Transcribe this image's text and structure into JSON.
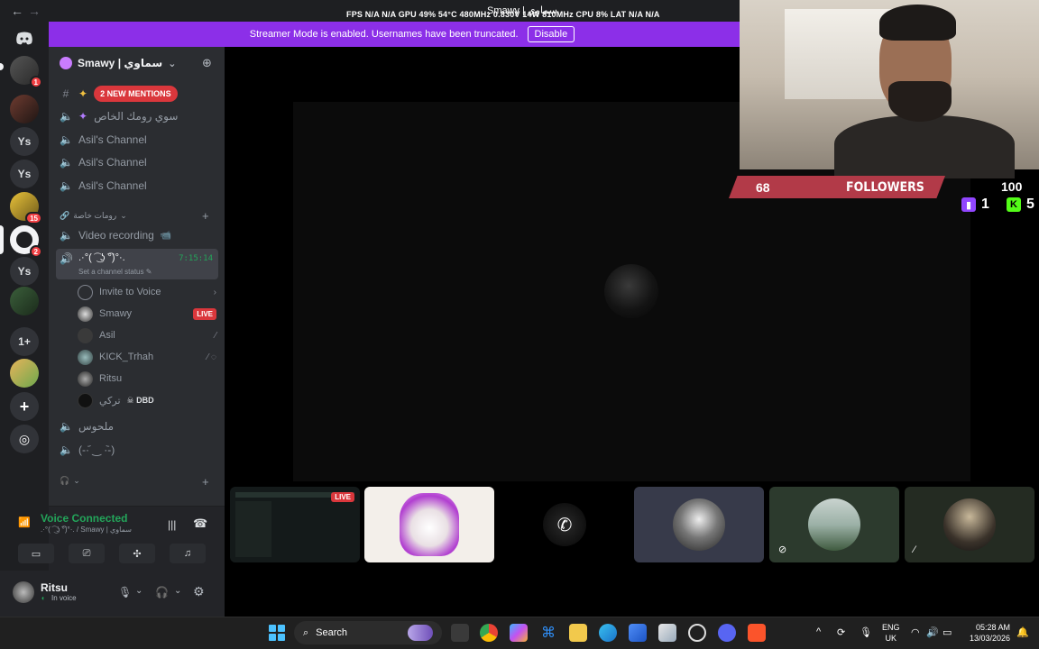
{
  "topbar": {
    "back_icon": "←",
    "forward_icon": "→",
    "overlay": "FPS N/A N/A   GPU 49% 54°C 480MHz 0.830V 14W 810MHz   CPU 8%   LAT N/A N/A",
    "window_title": "Smawy | سماوي"
  },
  "banner": {
    "text": "Streamer Mode is enabled. Usernames have been truncated.",
    "button": "Disable"
  },
  "servers": {
    "badges": [
      "1",
      "15",
      "2"
    ],
    "labels": [
      "Ys",
      "Ys",
      "Ys",
      "1+"
    ]
  },
  "guild": {
    "name": "Smawy | سماوي",
    "chevron": "⌄"
  },
  "channels": {
    "mentions": "2 NEW MENTIONS",
    "voice_1": "سوي رومك الخاص",
    "voice_2": "Asil's Channel",
    "voice_3": "Asil's Channel",
    "voice_4": "Asil's Channel",
    "category": "رومات خاصة",
    "video_recording": "Video recording",
    "active_channel": ".·°( ͡ ͜ ʖ ͡°)°·.",
    "active_timer": "7:15:14",
    "status_hint": "Set a channel status",
    "invite": "Invite to Voice",
    "voice_5": "ملحوس",
    "voice_6": "(-·᷄ ‿ ·᷅-)"
  },
  "members": [
    {
      "name": "Smawy",
      "badge": "LIVE"
    },
    {
      "name": "Asil"
    },
    {
      "name": "KICK_Trhah"
    },
    {
      "name": "Ritsu"
    },
    {
      "name": "تركي",
      "activity": "DBD"
    }
  ],
  "voice": {
    "title": "Voice Connected",
    "subtitle": ".·°( ͡ ͜ ʖ ͡°)°·. / Smawy | سماوي"
  },
  "user": {
    "name": "Ritsu",
    "status": "In voice"
  },
  "overlay_stats": {
    "followers_count": "68",
    "followers_label": "FOLLOWERS",
    "goal": "100",
    "twitch_count": "1",
    "kick_count": "5"
  },
  "taskbar": {
    "search": "Search",
    "lang_1": "ENG",
    "lang_2": "UK",
    "time": "05:28 AM",
    "date": "13/03/2026"
  },
  "colors": {
    "accent": "#8c2fe8",
    "danger": "#da373c",
    "online": "#23a55a",
    "sidebar": "#2b2d31",
    "rail": "#1e1f22"
  }
}
